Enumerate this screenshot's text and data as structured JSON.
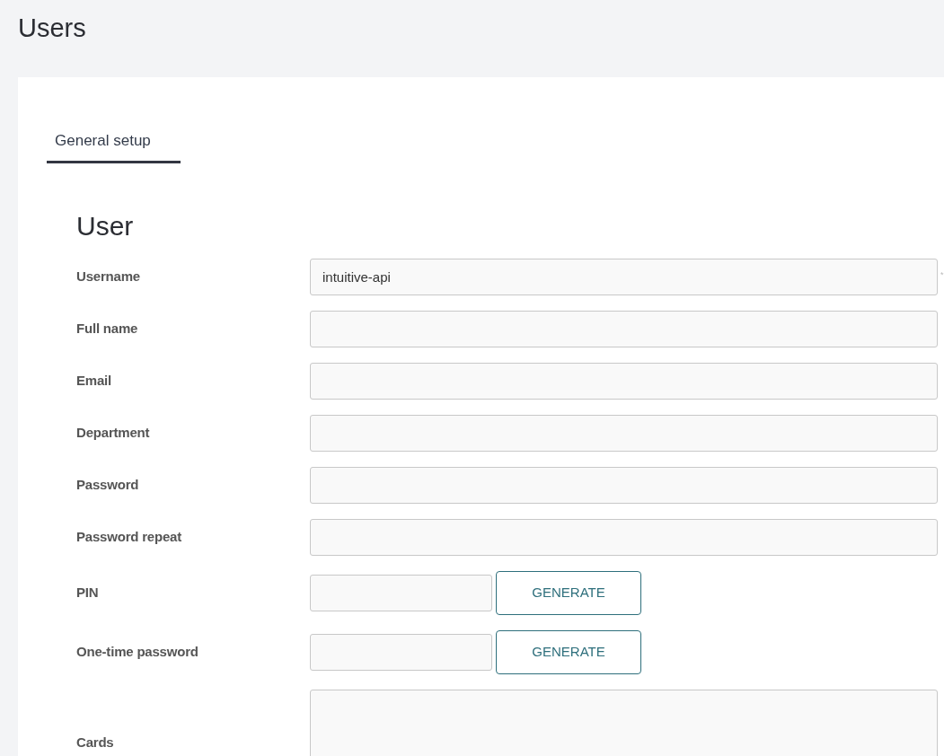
{
  "page_title": "Users",
  "tabs": [
    {
      "label": "General setup",
      "selected": true
    }
  ],
  "section_title": "User",
  "fields": [
    {
      "kind": "text",
      "label": "Username",
      "value": "intuitive-api",
      "required_mark": "*"
    },
    {
      "kind": "text",
      "label": "Full name"
    },
    {
      "kind": "text",
      "label": "Email"
    },
    {
      "kind": "text",
      "label": "Department"
    },
    {
      "kind": "text",
      "label": "Password"
    },
    {
      "kind": "text",
      "label": "Password repeat"
    },
    {
      "kind": "generate",
      "label": "PIN",
      "button": "GENERATE"
    },
    {
      "kind": "generate",
      "label": "One-time password",
      "button": "GENERATE"
    },
    {
      "kind": "textarea",
      "label": "Cards"
    }
  ]
}
